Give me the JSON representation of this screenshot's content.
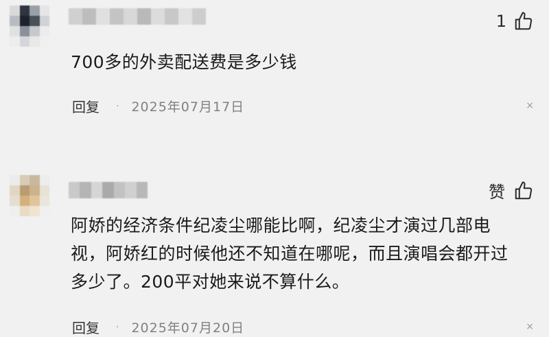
{
  "comments": [
    {
      "like_count": "1",
      "text": "700多的外卖配送费是多少钱",
      "reply_label": "回复",
      "separator": "·",
      "date": "2025年07月17日",
      "close_glyph": "×"
    },
    {
      "like_label": "赞",
      "text": "阿娇的经济条件纪凌尘哪能比啊，纪凌尘才演过几部电视，阿娇红的时候他还不知道在哪呢，而且演唱会都开过多少了。200平对她来说不算什么。",
      "reply_label": "回复",
      "separator": "·",
      "date": "2025年07月20日",
      "close_glyph": "×"
    }
  ],
  "icons": {
    "like": "thumbs-up-icon",
    "close": "close-icon"
  },
  "colors": {
    "background": "#f1f1f1",
    "text": "#1a1a1a",
    "meta": "#808080"
  }
}
